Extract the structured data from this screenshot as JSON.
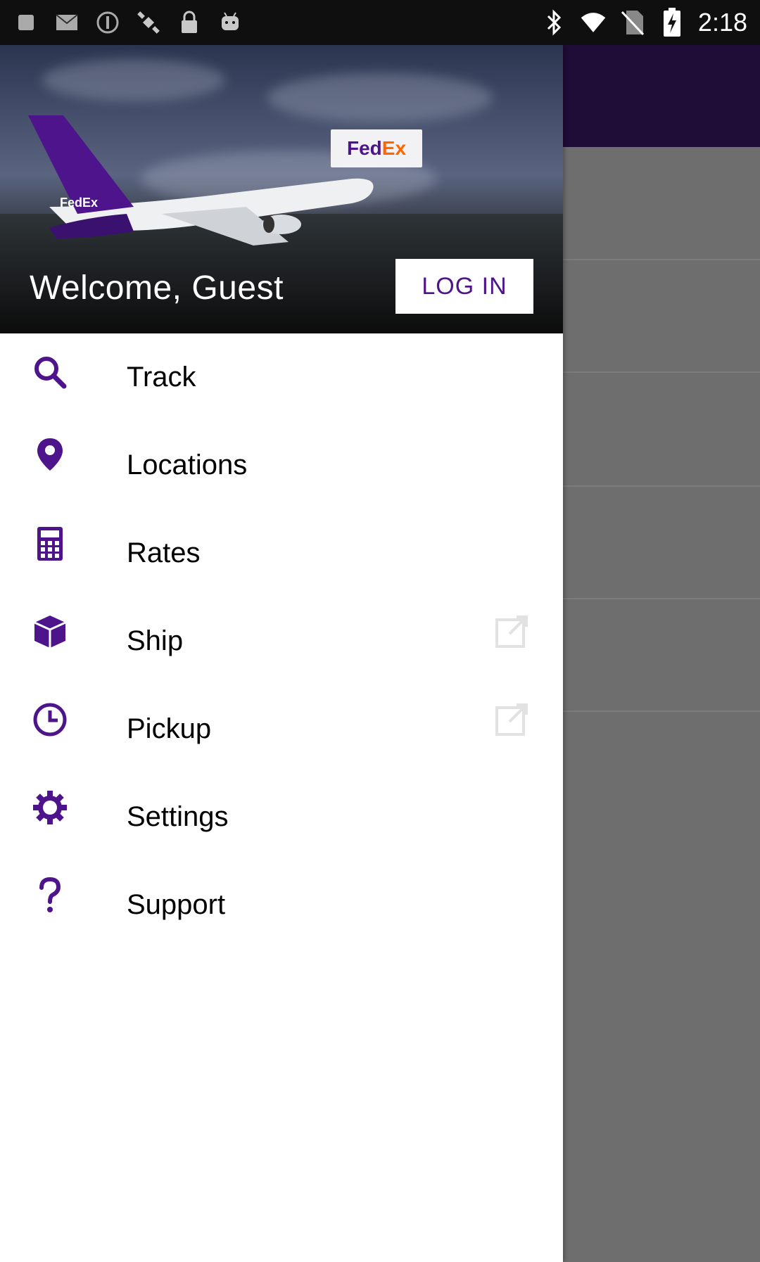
{
  "status_bar": {
    "time": "2:18",
    "left_icons": [
      "notification-icon",
      "mail-icon",
      "do-not-disturb-icon",
      "satellite-icon",
      "lock-icon",
      "android-icon"
    ],
    "right_icons": [
      "bluetooth-icon",
      "wifi-icon",
      "no-sim-icon",
      "battery-charging-icon"
    ]
  },
  "drawer": {
    "header": {
      "logo": {
        "fed": "Fed",
        "ex": "Ex"
      },
      "welcome": "Welcome, Guest",
      "login_label": "LOG IN"
    },
    "items": [
      {
        "label": "Track",
        "icon": "search-icon"
      },
      {
        "label": "Locations",
        "icon": "location-pin-icon"
      },
      {
        "label": "Rates",
        "icon": "calculator-icon"
      },
      {
        "label": "Ship",
        "icon": "package-icon",
        "external": true
      },
      {
        "label": "Pickup",
        "icon": "clock-icon",
        "external": true
      },
      {
        "label": "Settings",
        "icon": "gear-icon"
      },
      {
        "label": "Support",
        "icon": "question-mark-icon"
      }
    ]
  },
  "colors": {
    "brand_purple": "#4d148c",
    "brand_orange": "#ff6600",
    "toolbar": "#1f0c37"
  }
}
